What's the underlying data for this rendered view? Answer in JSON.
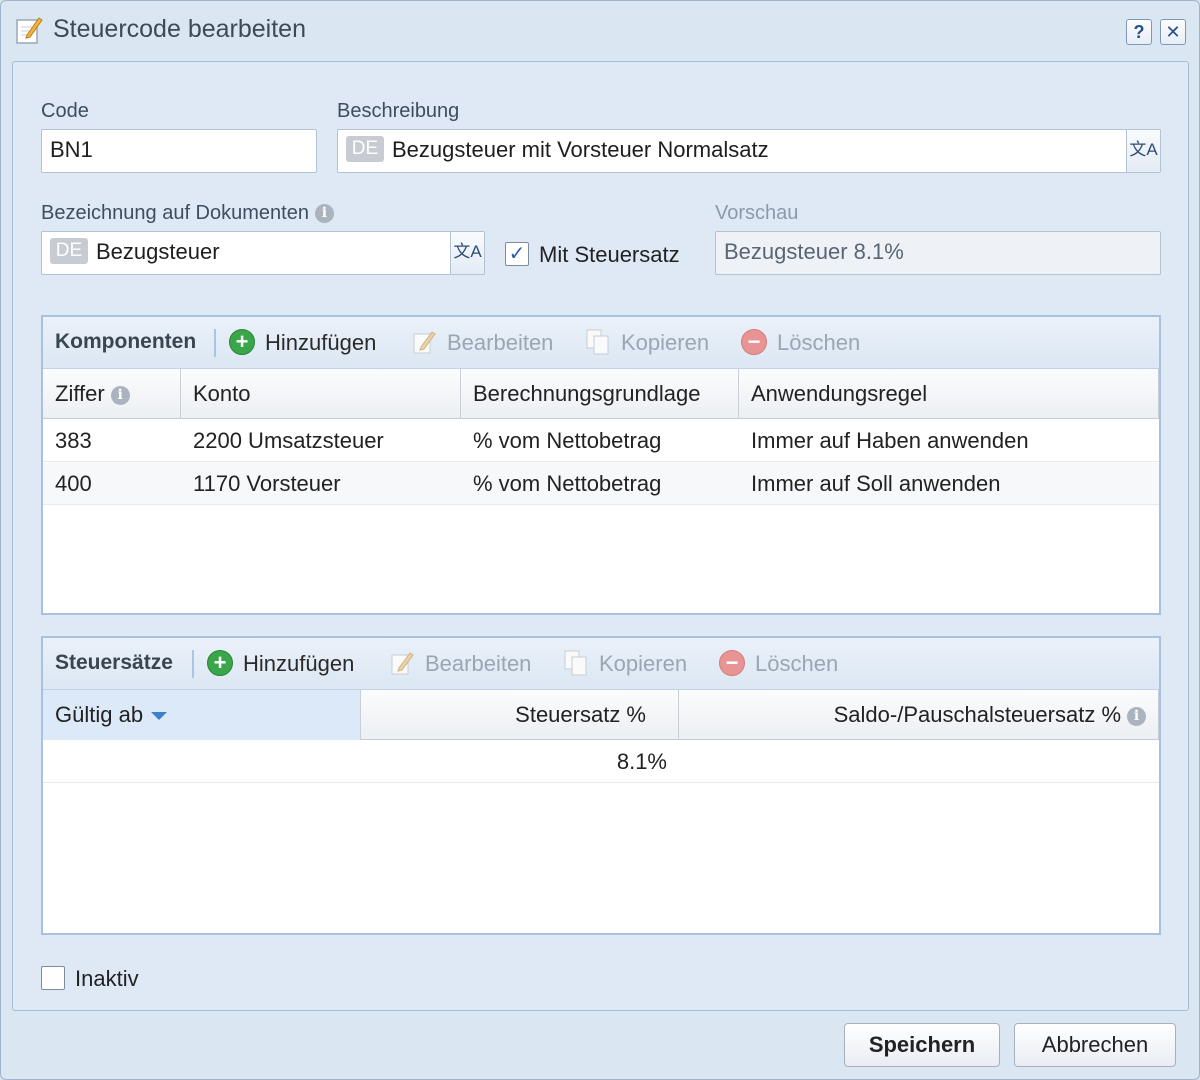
{
  "window": {
    "title": "Steuercode bearbeiten",
    "help_label": "?",
    "close_label": "✕"
  },
  "form": {
    "code_label": "Code",
    "code_value": "BN1",
    "beschreibung_label": "Beschreibung",
    "beschreibung_lang": "DE",
    "beschreibung_value": "Bezugsteuer mit Vorsteuer Normalsatz",
    "bezeichnung_label": "Bezeichnung auf Dokumenten",
    "bezeichnung_lang": "DE",
    "bezeichnung_value": "Bezugsteuer",
    "mit_steuersatz_label": "Mit Steuersatz",
    "mit_steuersatz_checked": true,
    "vorschau_label": "Vorschau",
    "vorschau_value": "Bezugsteuer 8.1%",
    "translate_glyph": "文A",
    "info_glyph": "i"
  },
  "komponenten": {
    "title": "Komponenten",
    "add_label": "Hinzufügen",
    "edit_label": "Bearbeiten",
    "copy_label": "Kopieren",
    "delete_label": "Löschen",
    "columns": [
      "Ziffer",
      "Konto",
      "Berechnungsgrundlage",
      "Anwendungsregel"
    ],
    "rows": [
      [
        "383",
        "2200 Umsatzsteuer",
        "% vom Nettobetrag",
        "Immer auf Haben anwenden"
      ],
      [
        "400",
        "1170 Vorsteuer",
        "% vom Nettobetrag",
        "Immer auf Soll anwenden"
      ]
    ]
  },
  "steuersaetze": {
    "title": "Steuersätze",
    "add_label": "Hinzufügen",
    "edit_label": "Bearbeiten",
    "copy_label": "Kopieren",
    "delete_label": "Löschen",
    "columns": [
      "Gültig ab",
      "Steuersatz %",
      "Saldo-/Pauschalsteuersatz %"
    ],
    "rows": [
      [
        "",
        "8.1%",
        ""
      ]
    ]
  },
  "inaktiv": {
    "label": "Inaktiv",
    "checked": false
  },
  "buttons": {
    "save": "Speichern",
    "cancel": "Abbrechen"
  },
  "colors": {
    "accent": "#3f7fd0",
    "add_green": "#3aa64a",
    "delete_red": "#e89495",
    "panel_border": "#a8c1de"
  }
}
